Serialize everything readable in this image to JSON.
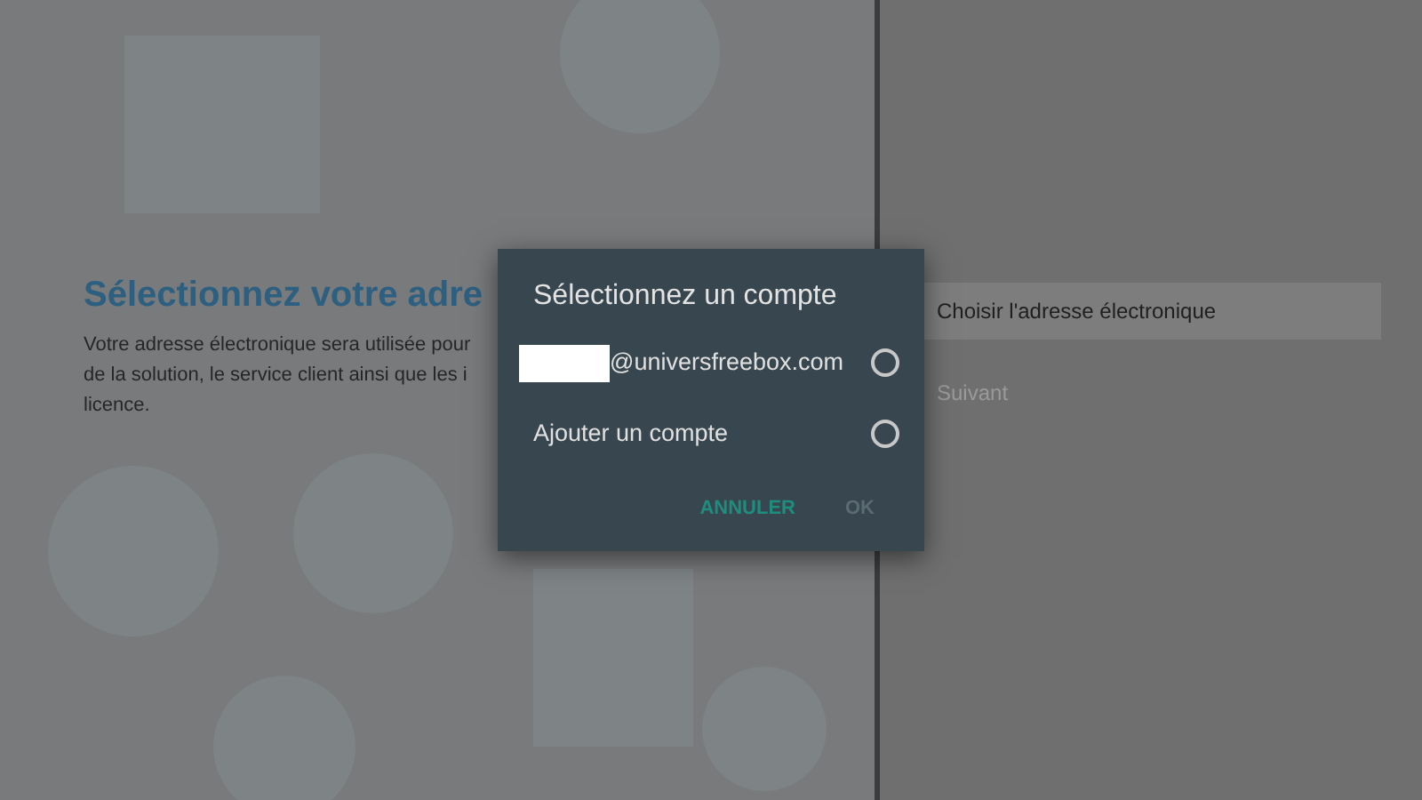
{
  "left_panel": {
    "title": "Sélectionnez votre adre",
    "description_lines": [
      "Votre adresse électronique sera utilisée pour",
      "de la solution, le service client ainsi que les i",
      "licence."
    ]
  },
  "right_panel": {
    "actions": [
      {
        "label": "Choisir l'adresse électronique",
        "selected": true,
        "disabled": false
      },
      {
        "label": "Suivant",
        "selected": false,
        "disabled": true
      }
    ]
  },
  "dialog": {
    "title": "Sélectionnez un compte",
    "options": [
      {
        "label": "@universfreebox.com",
        "redacted_prefix": true,
        "selected": false
      },
      {
        "label": "Ajouter un compte",
        "redacted_prefix": false,
        "selected": false
      }
    ],
    "buttons": [
      {
        "label": "ANNULER",
        "disabled": false
      },
      {
        "label": "OK",
        "disabled": true
      }
    ]
  }
}
